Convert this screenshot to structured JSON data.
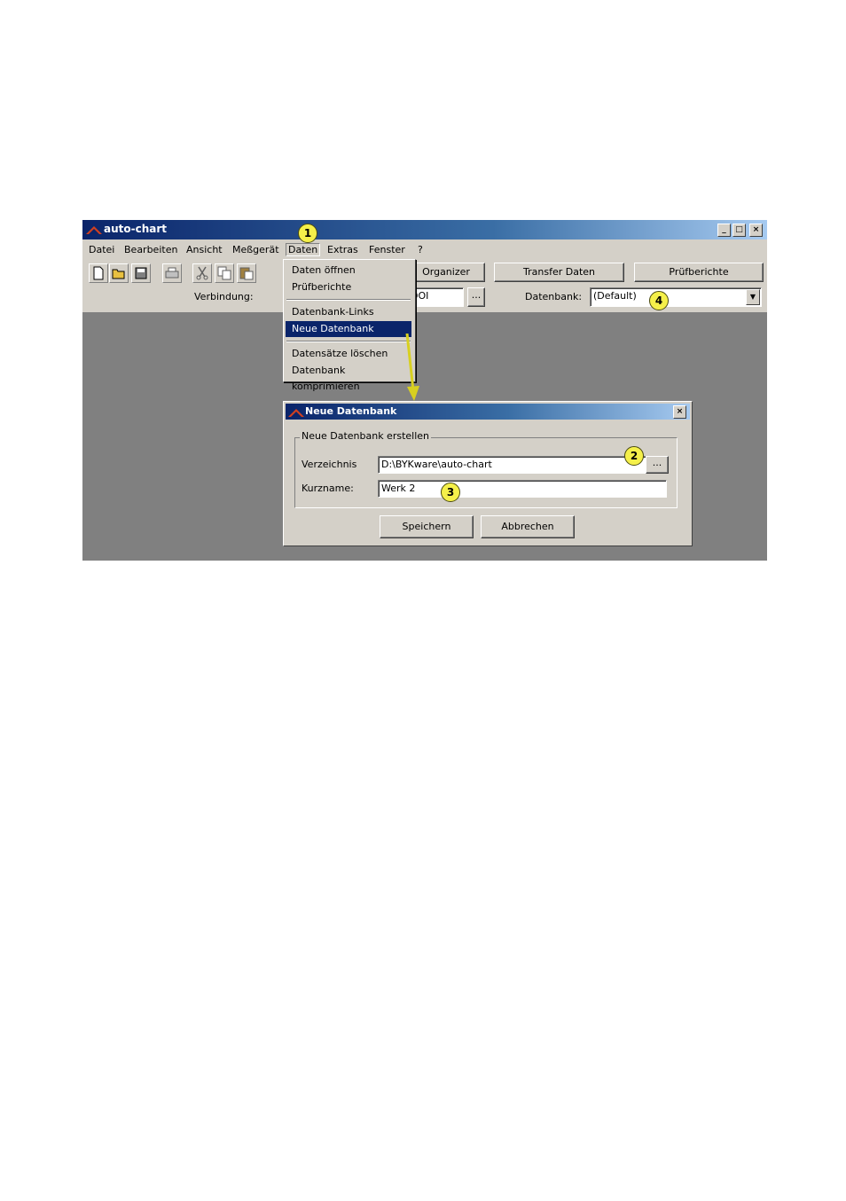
{
  "window": {
    "title": "auto-chart",
    "controls": [
      "_",
      "□",
      "×"
    ]
  },
  "menubar": {
    "items": [
      "Datei",
      "Bearbeiten",
      "Ansicht",
      "Meßgerät",
      "Daten",
      "Extras",
      "Fenster",
      "?"
    ]
  },
  "toolbar": {
    "icons": [
      "new-icon",
      "open-icon",
      "save-icon",
      "print-icon",
      "cut-icon",
      "copy-icon",
      "paste-icon"
    ],
    "organizer_label": "Organizer",
    "transfer_label": "Transfer Daten",
    "reports_label": "Prüfberichte",
    "connection_label": "Verbindung:",
    "connection_value": "DOI",
    "browse_label": "...",
    "database_label": "Datenbank:",
    "database_value": "(Default)"
  },
  "daten_menu": {
    "items": [
      "Daten öffnen",
      "Prüfberichte",
      "Datenbank-Links",
      "Neue Datenbank",
      "Datensätze löschen",
      "Datenbank komprimieren"
    ],
    "highlighted": "Neue Datenbank"
  },
  "dialog": {
    "title": "Neue Datenbank",
    "group_label": "Neue Datenbank erstellen",
    "directory_label": "Verzeichnis",
    "directory_value": "D:\\BYKware\\auto-chart",
    "browse_label": "...",
    "shortname_label": "Kurzname:",
    "shortname_value": "Werk 2",
    "save_label": "Speichern",
    "cancel_label": "Abbrechen"
  },
  "callouts": [
    "1",
    "2",
    "3",
    "4"
  ],
  "colors": {
    "titlebar": "#0a246a",
    "face": "#d4d0c8",
    "desktop": "#808080",
    "callout": "#f5f04a",
    "arrow": "#d8d020"
  }
}
